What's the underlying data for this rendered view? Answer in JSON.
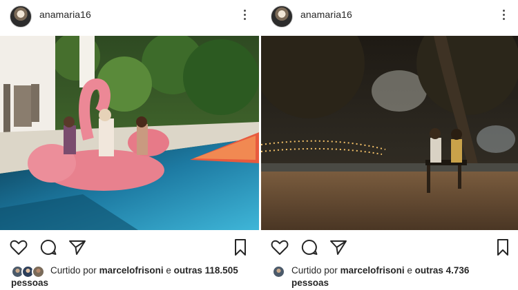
{
  "posts": [
    {
      "username": "anamaria16",
      "liked_prefix": "Curtido por",
      "liked_user": "marcelofrisoni",
      "liked_middle": "e",
      "liked_others": "outras 118.505",
      "liked_suffix": "pessoas",
      "icons": [
        "heart-icon",
        "comment-icon",
        "share-icon",
        "bookmark-icon"
      ]
    },
    {
      "username": "anamaria16",
      "liked_prefix": "Curtido por",
      "liked_user": "marcelofrisoni",
      "liked_middle": "e",
      "liked_others": "outras 4.736",
      "liked_suffix": "pessoas",
      "icons": [
        "heart-icon",
        "comment-icon",
        "share-icon",
        "bookmark-icon"
      ]
    }
  ]
}
